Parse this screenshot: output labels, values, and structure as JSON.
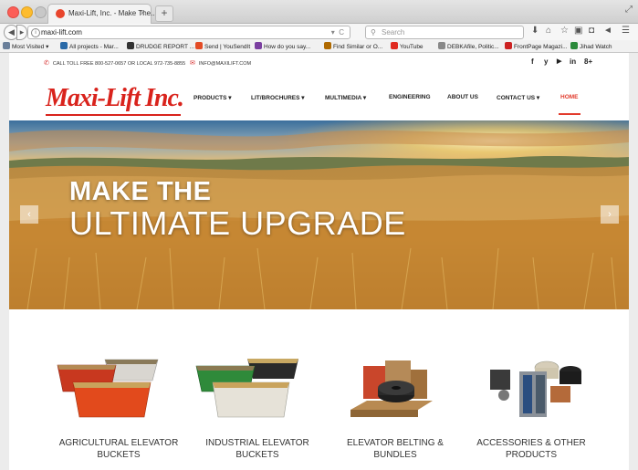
{
  "browser": {
    "tab_title": "Maxi-Lift, Inc. - Make The...",
    "tab_close": "×",
    "new_tab": "+",
    "url": "maxi-lift.com",
    "search_placeholder": "Search",
    "bookmarks": [
      {
        "label": "Most Visited ▾",
        "color": "#6a7f9a"
      },
      {
        "label": "All projects - Mar...",
        "color": "#2a6aa8"
      },
      {
        "label": "DRUDGE REPORT ...",
        "color": "#333333"
      },
      {
        "label": "Send | YouSendIt",
        "color": "#e34c26"
      },
      {
        "label": "How do you say...",
        "color": "#7b3fa0"
      },
      {
        "label": "Find Similar or O...",
        "color": "#b06a00"
      },
      {
        "label": "YouTube",
        "color": "#e02a20"
      },
      {
        "label": "DEBKAfile, Politic...",
        "color": "#888888"
      },
      {
        "label": "FrontPage Magazi...",
        "color": "#c22"
      },
      {
        "label": "Jihad Watch",
        "color": "#2a8a3a"
      }
    ]
  },
  "topbar": {
    "phone": "CALL TOLL FREE 800-527-0657 OR LOCAL 972-735-8855",
    "email": "INFO@MAXILIFT.COM",
    "social": [
      "f",
      "y",
      "in",
      "8+"
    ]
  },
  "header": {
    "logo": "Maxi-Lift Inc.",
    "menu": [
      {
        "label": "PRODUCTS ▾"
      },
      {
        "label": "LIT/BROCHURES ▾"
      },
      {
        "label": "MULTIMEDIA ▾"
      },
      {
        "label": "ENGINEERING"
      },
      {
        "label": "ABOUT US"
      },
      {
        "label": "CONTACT US ▾"
      },
      {
        "label": "HOME"
      }
    ]
  },
  "hero": {
    "line1": "MAKE THE",
    "line2": "ULTIMATE UPGRADE",
    "prev": "‹",
    "next": "›"
  },
  "products": [
    {
      "line1": "AGRICULTURAL ELEVATOR",
      "line2": "BUCKETS"
    },
    {
      "line1": "INDUSTRIAL ELEVATOR",
      "line2": "BUCKETS"
    },
    {
      "line1": "ELEVATOR BELTING &",
      "line2": "BUNDLES"
    },
    {
      "line1": "ACCESSORIES & OTHER",
      "line2": "PRODUCTS"
    }
  ],
  "colors": {
    "brand_red": "#d9231c",
    "active_menu": "#e23b2c"
  }
}
